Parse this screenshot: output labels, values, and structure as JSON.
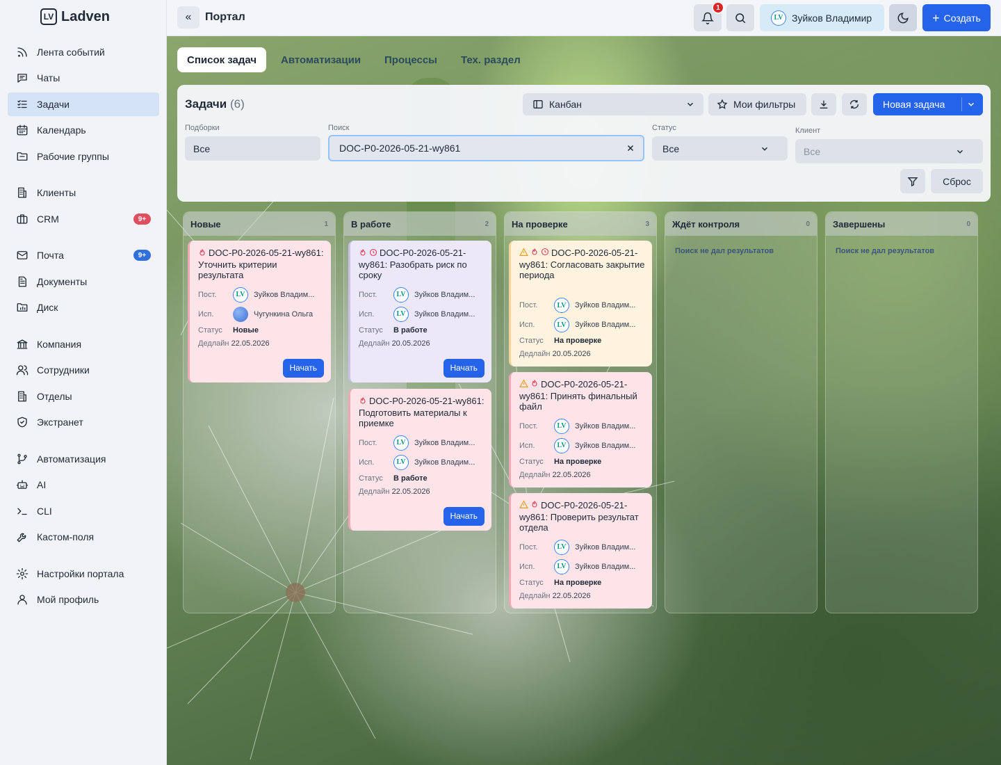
{
  "app": {
    "name": "Ladven",
    "logo_letters": "LV"
  },
  "sidebar": {
    "items": [
      {
        "label": "Лента событий",
        "icon": "rss-icon"
      },
      {
        "label": "Чаты",
        "icon": "chat-icon"
      },
      {
        "label": "Задачи",
        "icon": "tasks-icon",
        "active": true
      },
      {
        "label": "Календарь",
        "icon": "calendar-icon"
      },
      {
        "label": "Рабочие группы",
        "icon": "folder-icon"
      },
      {
        "label": "Клиенты",
        "icon": "building-icon"
      },
      {
        "label": "CRM",
        "icon": "briefcase-icon",
        "badge": "9+"
      },
      {
        "label": "Почта",
        "icon": "mail-icon",
        "badge": "9+"
      },
      {
        "label": "Документы",
        "icon": "document-icon"
      },
      {
        "label": "Диск",
        "icon": "disk-icon"
      },
      {
        "label": "Компания",
        "icon": "bank-icon"
      },
      {
        "label": "Сотрудники",
        "icon": "users-icon"
      },
      {
        "label": "Отделы",
        "icon": "departments-icon"
      },
      {
        "label": "Экстранет",
        "icon": "shield-icon"
      },
      {
        "label": "Автоматизация",
        "icon": "workflow-icon"
      },
      {
        "label": "AI",
        "icon": "robot-icon"
      },
      {
        "label": "CLI",
        "icon": "terminal-icon"
      },
      {
        "label": "Кастом-поля",
        "icon": "wrench-icon"
      },
      {
        "label": "Настройки портала",
        "icon": "gear-icon"
      },
      {
        "label": "Мой профиль",
        "icon": "user-icon"
      }
    ]
  },
  "header": {
    "title": "Портал",
    "collapse_glyph": "«",
    "notifications_count": "1",
    "user_name": "Зуйков Владимир",
    "user_initials": "LV",
    "create_label": "Создать"
  },
  "tabs": [
    {
      "label": "Список задач",
      "active": true
    },
    {
      "label": "Автоматизации"
    },
    {
      "label": "Процессы"
    },
    {
      "label": "Тех. раздел"
    }
  ],
  "panel": {
    "title": "Задачи",
    "count": "(6)",
    "view_select": "Канбан",
    "my_filters_label": "Мои фильтры",
    "new_task_label": "Новая задача",
    "reset_label": "Сброс",
    "filters": {
      "collections": {
        "label": "Подборки",
        "value": "Все"
      },
      "search": {
        "label": "Поиск",
        "value": "DOC-P0-2026-05-21-wy861"
      },
      "status": {
        "label": "Статус",
        "value": "Все"
      },
      "client": {
        "label": "Клиент",
        "value": "Все"
      }
    }
  },
  "kanban": {
    "field_labels": {
      "author": "Пост.",
      "assignee": "Исп.",
      "status": "Статус",
      "deadline": "Дедлайн"
    },
    "start_label": "Начать",
    "empty_label": "Поиск не дал результатов",
    "columns": [
      {
        "title": "Новые",
        "count": "1",
        "cards": [
          {
            "title": "DOC-P0-2026-05-21-wy861: Уточнить критерии результата",
            "author": "Зуйков Владим...",
            "assignee": "Чугункина Ольга",
            "status": "Новые",
            "deadline": "22.05.2026",
            "color": "pink"
          }
        ]
      },
      {
        "title": "В работе",
        "count": "2",
        "cards": [
          {
            "title": "DOC-P0-2026-05-21-wy861: Разобрать риск по сроку",
            "author": "Зуйков Владим...",
            "assignee": "Зуйков Владим...",
            "status": "В работе",
            "deadline": "20.05.2026",
            "color": "lavender"
          },
          {
            "title": "DOC-P0-2026-05-21-wy861: Подготовить материалы к приемке",
            "author": "Зуйков Владим...",
            "assignee": "Зуйков Владим...",
            "status": "В работе",
            "deadline": "22.05.2026",
            "color": "pink"
          }
        ]
      },
      {
        "title": "На проверке",
        "count": "3",
        "cards": [
          {
            "title": "DOC-P0-2026-05-21-wy861: Согласовать закрытие периода",
            "author": "Зуйков Владим...",
            "assignee": "Зуйков Владим...",
            "status": "На проверке",
            "deadline": "20.05.2026",
            "color": "cream"
          },
          {
            "title": "DOC-P0-2026-05-21-wy861: Принять финальный файл",
            "author": "Зуйков Владим...",
            "assignee": "Зуйков Владим...",
            "status": "На проверке",
            "deadline": "22.05.2026",
            "color": "pink"
          },
          {
            "title": "DOC-P0-2026-05-21-wy861: Проверить результат отдела",
            "author": "Зуйков Владим...",
            "assignee": "Зуйков Владим...",
            "status": "На проверке",
            "deadline": "22.05.2026",
            "color": "pink"
          }
        ]
      },
      {
        "title": "Ждёт контроля",
        "count": "0",
        "cards": []
      },
      {
        "title": "Завершены",
        "count": "0",
        "cards": []
      }
    ]
  },
  "colors": {
    "accent": "#2563eb",
    "badge_red": "#e04f5f",
    "badge_blue": "#2f6fe0",
    "active_nav": "#d5e3f7"
  }
}
